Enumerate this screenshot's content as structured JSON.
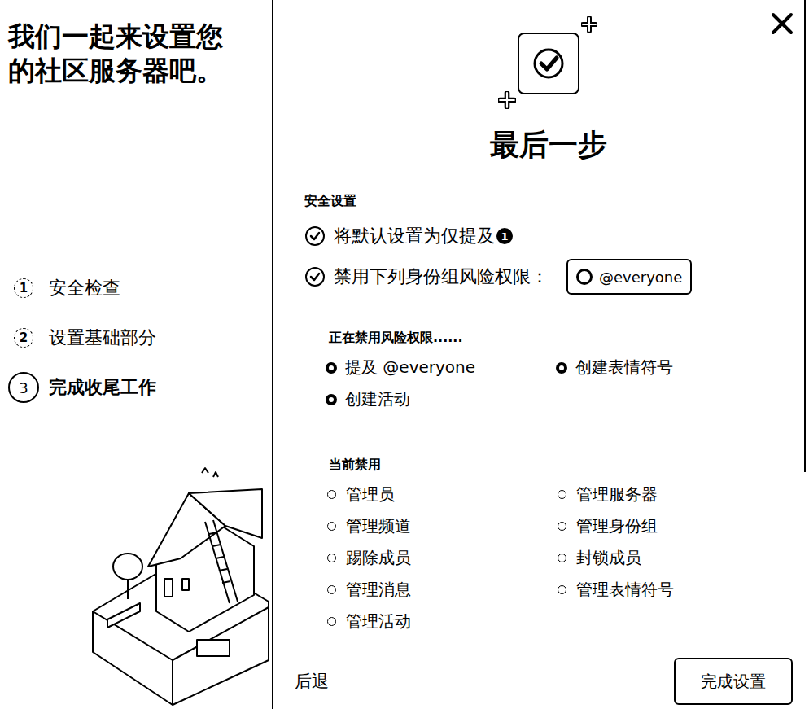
{
  "sidebar": {
    "title": "我们一起来设置您的社区服务器吧。",
    "steps": [
      {
        "number": "1",
        "label": "安全检查",
        "selected": false
      },
      {
        "number": "2",
        "label": "设置基础部分",
        "selected": false
      },
      {
        "number": "3",
        "label": "完成收尾工作",
        "selected": true
      }
    ]
  },
  "heading": "最后一步",
  "security": {
    "title": "安全设置",
    "options": [
      {
        "label": "将默认设置为仅提及",
        "badge": "1",
        "checked": true,
        "role": null
      },
      {
        "label": "禁用下列身份组风险权限：",
        "badge": null,
        "checked": true,
        "role": {
          "name": "@everyone",
          "selected": false
        }
      }
    ]
  },
  "disabling": {
    "title": "正在禁用风险权限......",
    "items": [
      "提及 @everyone",
      "创建表情符号",
      "创建活动"
    ]
  },
  "current": {
    "title": "当前禁用",
    "items": [
      "管理员",
      "管理服务器",
      "管理频道",
      "管理身份组",
      "踢除成员",
      "封锁成员",
      "管理消息",
      "管理表情符号",
      "管理活动"
    ]
  },
  "buttons": {
    "back": "后退",
    "finish": "完成设置"
  }
}
